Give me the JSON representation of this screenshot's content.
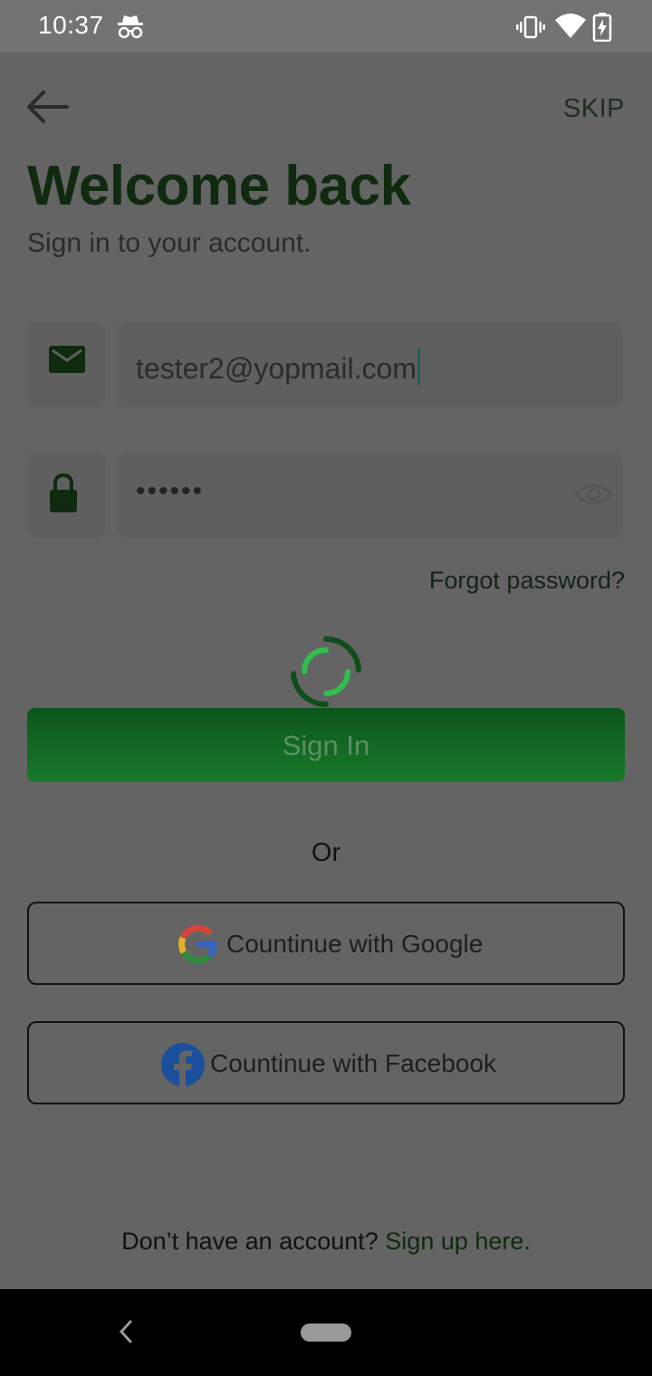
{
  "status_bar": {
    "time": "10:37",
    "icons": [
      "incognito-icon",
      "vibrate-icon",
      "wifi-icon",
      "battery-charging-icon"
    ]
  },
  "header": {
    "back_icon": "arrow-left-icon",
    "skip_label": "SKIP"
  },
  "welcome": {
    "title": "Welcome back",
    "subtitle": "Sign in to your account."
  },
  "form": {
    "email_icon": "mail-icon",
    "email_value": "tester2@yopmail.com",
    "password_icon": "lock-icon",
    "password_value": "••••••",
    "password_toggle_icon": "eye-icon",
    "forgot_password": "Forgot password?"
  },
  "loading": {
    "spinner": "loading-spinner"
  },
  "signin": {
    "label": "Sign In"
  },
  "separator": {
    "label": "Or"
  },
  "social": {
    "google_label": "Countinue with Google",
    "facebook_label": "Countinue with Facebook"
  },
  "footer": {
    "prompt": "Don’t have an account?",
    "signup_link": "Sign up here."
  },
  "colors": {
    "overlay_bg": "#646464",
    "title_green": "#0f2a0f",
    "button_green": "#177a2b",
    "spinner_light": "#2fbf4f",
    "spinner_dark": "#0f4d1a"
  }
}
